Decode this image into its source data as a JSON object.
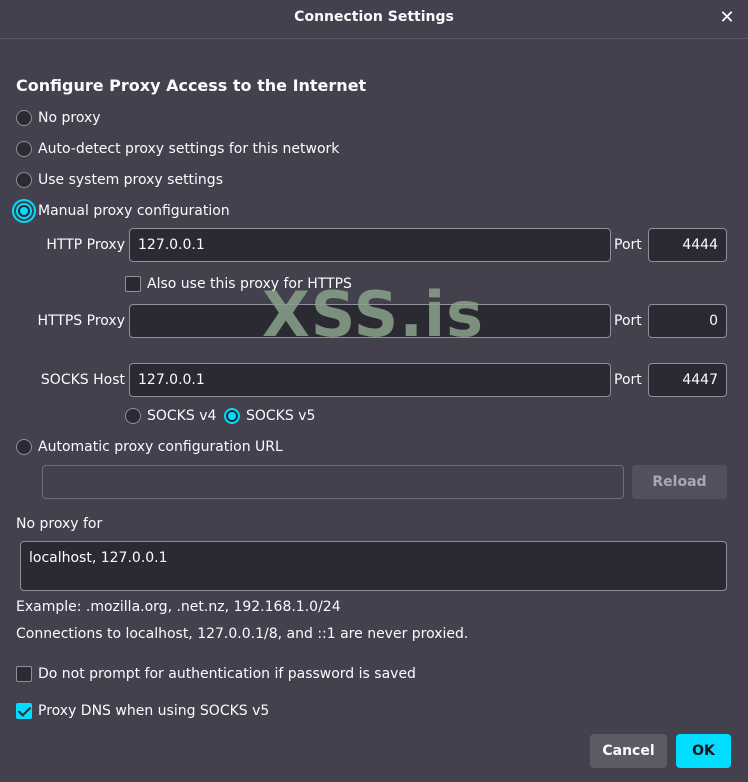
{
  "dialog": {
    "title": "Connection Settings"
  },
  "heading": "Configure Proxy Access to the Internet",
  "options": {
    "no_proxy": "No proxy",
    "auto_detect": "Auto-detect proxy settings for this network",
    "system": "Use system proxy settings",
    "manual": "Manual proxy configuration",
    "auto_url": "Automatic proxy configuration URL"
  },
  "http": {
    "label": "HTTP Proxy",
    "value": "127.0.0.1",
    "port_label": "Port",
    "port": "4444"
  },
  "also_https": "Also use this proxy for HTTPS",
  "https": {
    "label": "HTTPS Proxy",
    "value": "",
    "port_label": "Port",
    "port": "0"
  },
  "socks": {
    "label": "SOCKS Host",
    "value": "127.0.0.1",
    "port_label": "Port",
    "port": "4447",
    "v4": "SOCKS v4",
    "v5": "SOCKS v5"
  },
  "auto_url_value": "",
  "reload_label": "Reload",
  "no_proxy_for": {
    "label": "No proxy for",
    "value": "localhost, 127.0.0.1"
  },
  "example_text": "Example: .mozilla.org, .net.nz, 192.168.1.0/24",
  "localhost_note": "Connections to localhost, 127.0.0.1/8, and ::1 are never proxied.",
  "no_prompt_auth": "Do not prompt for authentication if password is saved",
  "proxy_dns": "Proxy DNS when using SOCKS v5",
  "buttons": {
    "cancel": "Cancel",
    "ok": "OK"
  },
  "watermark": "XSS.is",
  "colors": {
    "accent": "#00ddff",
    "background": "#42414d",
    "field": "#2b2a33"
  }
}
